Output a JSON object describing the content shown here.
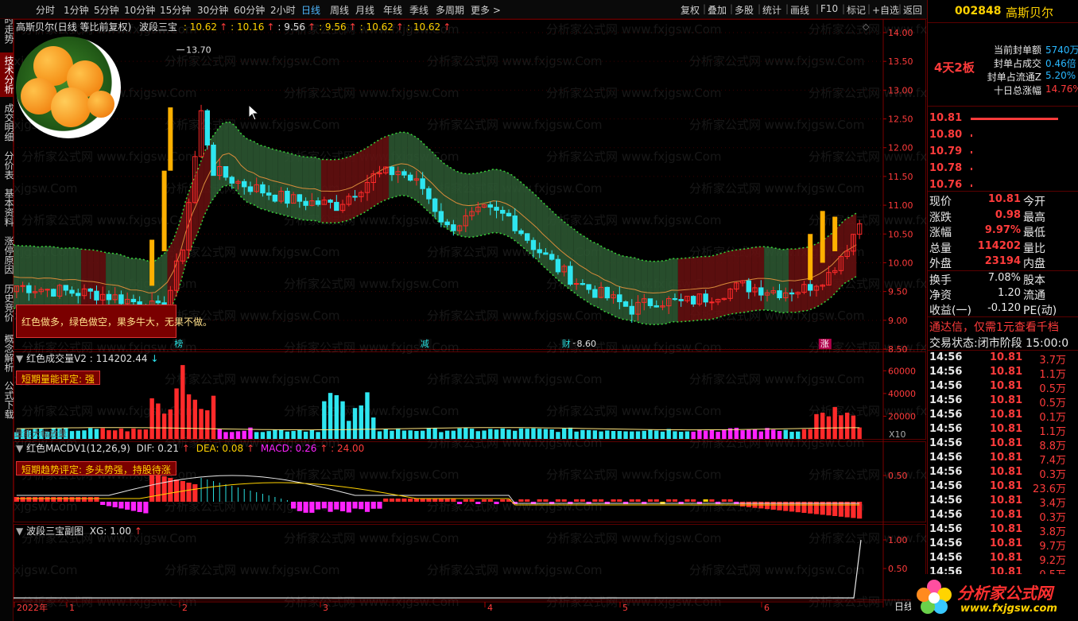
{
  "toolbar": {
    "items": [
      "分时",
      "1分钟",
      "5分钟",
      "10分钟",
      "15分钟",
      "30分钟",
      "60分钟",
      "2小时",
      "日线",
      "周线",
      "月线",
      "年线",
      "季线",
      "多周期",
      "更多"
    ],
    "active": "日线",
    "right_items": [
      "复权",
      "叠加",
      "多股",
      "统计",
      "画线",
      "F10",
      "标记",
      "+自选",
      "返回"
    ]
  },
  "leftnav": {
    "items": [
      "分时走势",
      "技术分析",
      "成交明细",
      "分价表",
      "基本资料",
      "涨停原因",
      "历史竞价",
      "概念解析",
      "公式下载"
    ],
    "active": "技术分析"
  },
  "main_pane": {
    "stock_title": "高斯贝尔(日线 等比前复权)",
    "indicator_name": "波段三宝",
    "indicator_values": [
      ": 10.62",
      ": 10.16",
      ": 9.56",
      ": 9.56",
      ": 10.62",
      ": 10.62"
    ],
    "high_label": "13.70",
    "low_label": "8.60",
    "y_ticks": [
      "14.00",
      "13.50",
      "13.00",
      "12.50",
      "12.00",
      "11.50",
      "11.00",
      "10.50",
      "10.00",
      "9.50",
      "9.00",
      "8.50"
    ],
    "note": "红色做多，绿色做空，果多牛大，无果不做。",
    "event_marks": [
      {
        "label": "榜",
        "x_idx": 26
      },
      {
        "label": "减",
        "x_idx": 66
      },
      {
        "label": "财",
        "x_idx": 89
      },
      {
        "label": "涨",
        "x_idx": 131
      }
    ]
  },
  "volume_pane": {
    "title": "红色成交量V2",
    "value": ": 114202.44",
    "note_label": "短期量能评定:",
    "note_value": "强",
    "y_ticks": [
      "60000",
      "40000",
      "20000"
    ],
    "unit": "X10",
    "sub_label": "量能大幅放量"
  },
  "macd_pane": {
    "title": "红色MACDV1(12,26,9)",
    "dif": "DIF: 0.21",
    "dea": "DEA: 0.08",
    "macd": "MACD: 0.26",
    "extra": ": 24.00",
    "note": "短期趋势评定: 多头势强，持股待涨",
    "y_ticks": [
      "0.50"
    ]
  },
  "sub_pane": {
    "title": "波段三宝副图",
    "xg": "XG: 1.00",
    "y_ticks": [
      "1.00",
      "0.50"
    ]
  },
  "x_axis": {
    "labels": [
      "2022年",
      "1",
      "2",
      "3",
      "4",
      "5",
      "6"
    ],
    "period_label": "日线"
  },
  "right_panel": {
    "code": "002848",
    "name": "高斯贝尔",
    "board_tag": "4天2板",
    "seal_stats": [
      {
        "label": "当前封单额",
        "value": "5740万"
      },
      {
        "label": "封单占成交",
        "value": "0.46倍"
      },
      {
        "label": "封单占流通Z",
        "value": "5.20%"
      },
      {
        "label": "十日总涨幅",
        "value": "14.76%"
      }
    ],
    "order_book": [
      {
        "price": "10.81",
        "bar": 110
      },
      {
        "price": "10.80",
        "bar": 2
      },
      {
        "price": "10.79",
        "bar": 2
      },
      {
        "price": "10.78",
        "bar": 2
      },
      {
        "price": "10.76",
        "bar": 2
      }
    ],
    "quote": [
      {
        "l": "现价",
        "v": "10.81",
        "r": "今开"
      },
      {
        "l": "涨跌",
        "v": "0.98",
        "r": "最高"
      },
      {
        "l": "涨幅",
        "v": "9.97%",
        "r": "最低"
      },
      {
        "l": "总量",
        "v": "114202",
        "r": "量比"
      },
      {
        "l": "外盘",
        "v": "23194",
        "r": "内盘"
      }
    ],
    "quote2": [
      {
        "l": "换手",
        "v": "7.08%",
        "r": "股本"
      },
      {
        "l": "净资",
        "v": "1.20",
        "r": "流通"
      },
      {
        "l": "收益(一)",
        "v": "-0.120",
        "r": "PE(动)"
      }
    ],
    "promo": "通达信，仅需1元查看千档",
    "trade_status_label": "交易状态:",
    "trade_status": "闭市阶段 15:00:0",
    "trades": [
      {
        "t": "14:56",
        "p": "10.81",
        "v": "3.7万"
      },
      {
        "t": "14:56",
        "p": "10.81",
        "v": "1.1万"
      },
      {
        "t": "14:56",
        "p": "10.81",
        "v": "0.5万"
      },
      {
        "t": "14:56",
        "p": "10.81",
        "v": "0.5万"
      },
      {
        "t": "14:56",
        "p": "10.81",
        "v": "0.1万"
      },
      {
        "t": "14:56",
        "p": "10.81",
        "v": "1.1万"
      },
      {
        "t": "14:56",
        "p": "10.81",
        "v": "8.8万"
      },
      {
        "t": "14:56",
        "p": "10.81",
        "v": "7.4万"
      },
      {
        "t": "14:56",
        "p": "10.81",
        "v": "0.3万"
      },
      {
        "t": "14:56",
        "p": "10.81",
        "v": "23.6万"
      },
      {
        "t": "14:56",
        "p": "10.81",
        "v": "3.4万"
      },
      {
        "t": "14:56",
        "p": "10.81",
        "v": "0.3万"
      },
      {
        "t": "14:56",
        "p": "10.81",
        "v": "3.8万"
      },
      {
        "t": "14:56",
        "p": "10.81",
        "v": "9.7万"
      },
      {
        "t": "14:56",
        "p": "10.81",
        "v": "9.2万"
      },
      {
        "t": "14:56",
        "p": "10.81",
        "v": "0.5万"
      }
    ],
    "logo_text": "分析家公式网",
    "logo_url_text": "www.fxjgsw.com"
  },
  "watermark_text": "分析家公式网 www.fxjgsw.Com",
  "colors": {
    "up": "#ff2a2a",
    "down": "#2ee6f0",
    "green_zone": "#2e5a34",
    "red_zone": "#6a1010",
    "signal": "#ffb000",
    "magenta": "#ff22ff"
  },
  "chart_data": {
    "type": "candlestick",
    "ylim": [
      8.5,
      14.0
    ],
    "series": [
      {
        "name": "波段三宝",
        "values": []
      }
    ]
  }
}
